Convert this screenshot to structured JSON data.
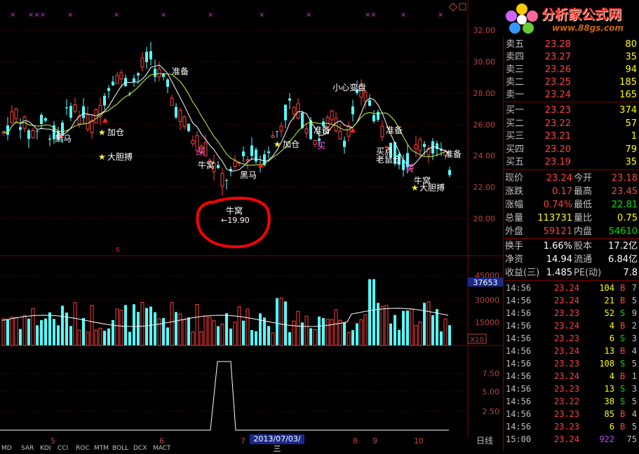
{
  "logo": {
    "brand": "分析家公式网",
    "url": "www.88gs.com"
  },
  "chart": {
    "price_axis": [
      "32.00",
      "30.00",
      "28.00",
      "26.00",
      "24.00",
      "22.00",
      "20.00"
    ],
    "volume_axis": [
      "45000",
      "30000",
      "15000"
    ],
    "volume_unit": "X10",
    "volume_current": "37653",
    "indicator_axis": [
      "7.50",
      "5.00",
      "2.50"
    ],
    "month_labels": [
      "5",
      "6",
      "7",
      "8",
      "9",
      "10"
    ],
    "date_badge": "2013/07/03/三",
    "period_tab": "日线",
    "annotations": {
      "heima1": "黑马",
      "heima2": "黑马",
      "jiacang1": "加仓",
      "jiacang2": "加仓",
      "dadanbo1": "大胆搏",
      "dadanbo2": "大胆搏",
      "zhunbei1": "准备",
      "zhunbei2": "准备",
      "zhunbei3": "准备",
      "zhunbei4": "准备",
      "niuwo1": "牛窝",
      "niuwo2": "牛窝",
      "niuwo3": "牛窝",
      "xiaoxin": "小心变盘",
      "mai1": "买",
      "mai2": "买",
      "mai3": "买",
      "mai4": "买点",
      "laoshu": "老鼠仓",
      "low_price": "←19.90",
      "s_marker": "s"
    },
    "bottom_indicators": [
      "MD",
      "SAR",
      "KDJ",
      "CCI",
      "ROC",
      "MTM",
      "BOLL",
      "DCX",
      "MACT"
    ]
  },
  "quotes": {
    "asks": [
      {
        "label": "卖五",
        "price": "23.28",
        "vol": "80"
      },
      {
        "label": "卖四",
        "price": "23.27",
        "vol": "35"
      },
      {
        "label": "卖三",
        "price": "23.26",
        "vol": "94"
      },
      {
        "label": "卖二",
        "price": "23.25",
        "vol": "185"
      },
      {
        "label": "卖一",
        "price": "23.24",
        "vol": "165"
      }
    ],
    "bids": [
      {
        "label": "买一",
        "price": "23.23",
        "vol": "374"
      },
      {
        "label": "买二",
        "price": "23.22",
        "vol": "57"
      },
      {
        "label": "买三",
        "price": "23.21",
        "vol": "1"
      },
      {
        "label": "买四",
        "price": "23.20",
        "vol": "79"
      },
      {
        "label": "买五",
        "price": "23.19",
        "vol": "35"
      }
    ]
  },
  "stats": [
    {
      "k1": "现价",
      "v1": "23.24",
      "c1": "red",
      "k2": "今开",
      "v2": "23.18",
      "c2": "red"
    },
    {
      "k1": "涨跌",
      "v1": "0.17",
      "c1": "red",
      "k2": "最高",
      "v2": "23.45",
      "c2": "red"
    },
    {
      "k1": "涨幅",
      "v1": "0.74%",
      "c1": "red",
      "k2": "最低",
      "v2": "22.81",
      "c2": "grn"
    },
    {
      "k1": "总量",
      "v1": "113731",
      "c1": "yel",
      "k2": "量比",
      "v2": "0.75",
      "c2": "yel"
    },
    {
      "k1": "外盘",
      "v1": "59121",
      "c1": "red",
      "k2": "内盘",
      "v2": "54610",
      "c2": "grn"
    }
  ],
  "stats2": [
    {
      "k1": "换手",
      "v1": "1.66%",
      "k2": "股本",
      "v2": "17.2亿"
    },
    {
      "k1": "净资",
      "v1": "14.94",
      "k2": "流通",
      "v2": "6.84亿"
    },
    {
      "k1": "收益(三)",
      "v1": "1.485",
      "k2": "PE(动)",
      "v2": "7.8"
    }
  ],
  "ticks": [
    {
      "t": "14:56",
      "p": "23.24",
      "pc": "red",
      "v": "104",
      "d": "B",
      "n": "7"
    },
    {
      "t": "14:56",
      "p": "23.24",
      "pc": "red",
      "v": "21",
      "d": "B",
      "n": "5"
    },
    {
      "t": "14:56",
      "p": "23.23",
      "pc": "red",
      "v": "52",
      "d": "S",
      "n": "9"
    },
    {
      "t": "14:56",
      "p": "23.24",
      "pc": "red",
      "v": "4",
      "d": "B",
      "n": "2"
    },
    {
      "t": "14:56",
      "p": "23.23",
      "pc": "red",
      "v": "6",
      "d": "S",
      "n": "3"
    },
    {
      "t": "14:56",
      "p": "23.24",
      "pc": "red",
      "v": "13",
      "d": "B",
      "n": "4"
    },
    {
      "t": "14:56",
      "p": "23.23",
      "pc": "red",
      "v": "108",
      "d": "S",
      "n": "5"
    },
    {
      "t": "14:56",
      "p": "23.24",
      "pc": "red",
      "v": "4",
      "d": "B",
      "n": "1"
    },
    {
      "t": "14:56",
      "p": "23.23",
      "pc": "red",
      "v": "13",
      "d": "S",
      "n": "3"
    },
    {
      "t": "14:56",
      "p": "23.22",
      "pc": "red",
      "v": "38",
      "d": "S",
      "n": "5"
    },
    {
      "t": "14:56",
      "p": "23.23",
      "pc": "red",
      "v": "85",
      "d": "B",
      "n": "4"
    },
    {
      "t": "14:56",
      "p": "23.23",
      "pc": "red",
      "v": "6",
      "d": "B",
      "n": "5"
    },
    {
      "t": "15:00",
      "p": "23.24",
      "pc": "red",
      "v": "922",
      "d": "",
      "n": "75"
    }
  ]
}
